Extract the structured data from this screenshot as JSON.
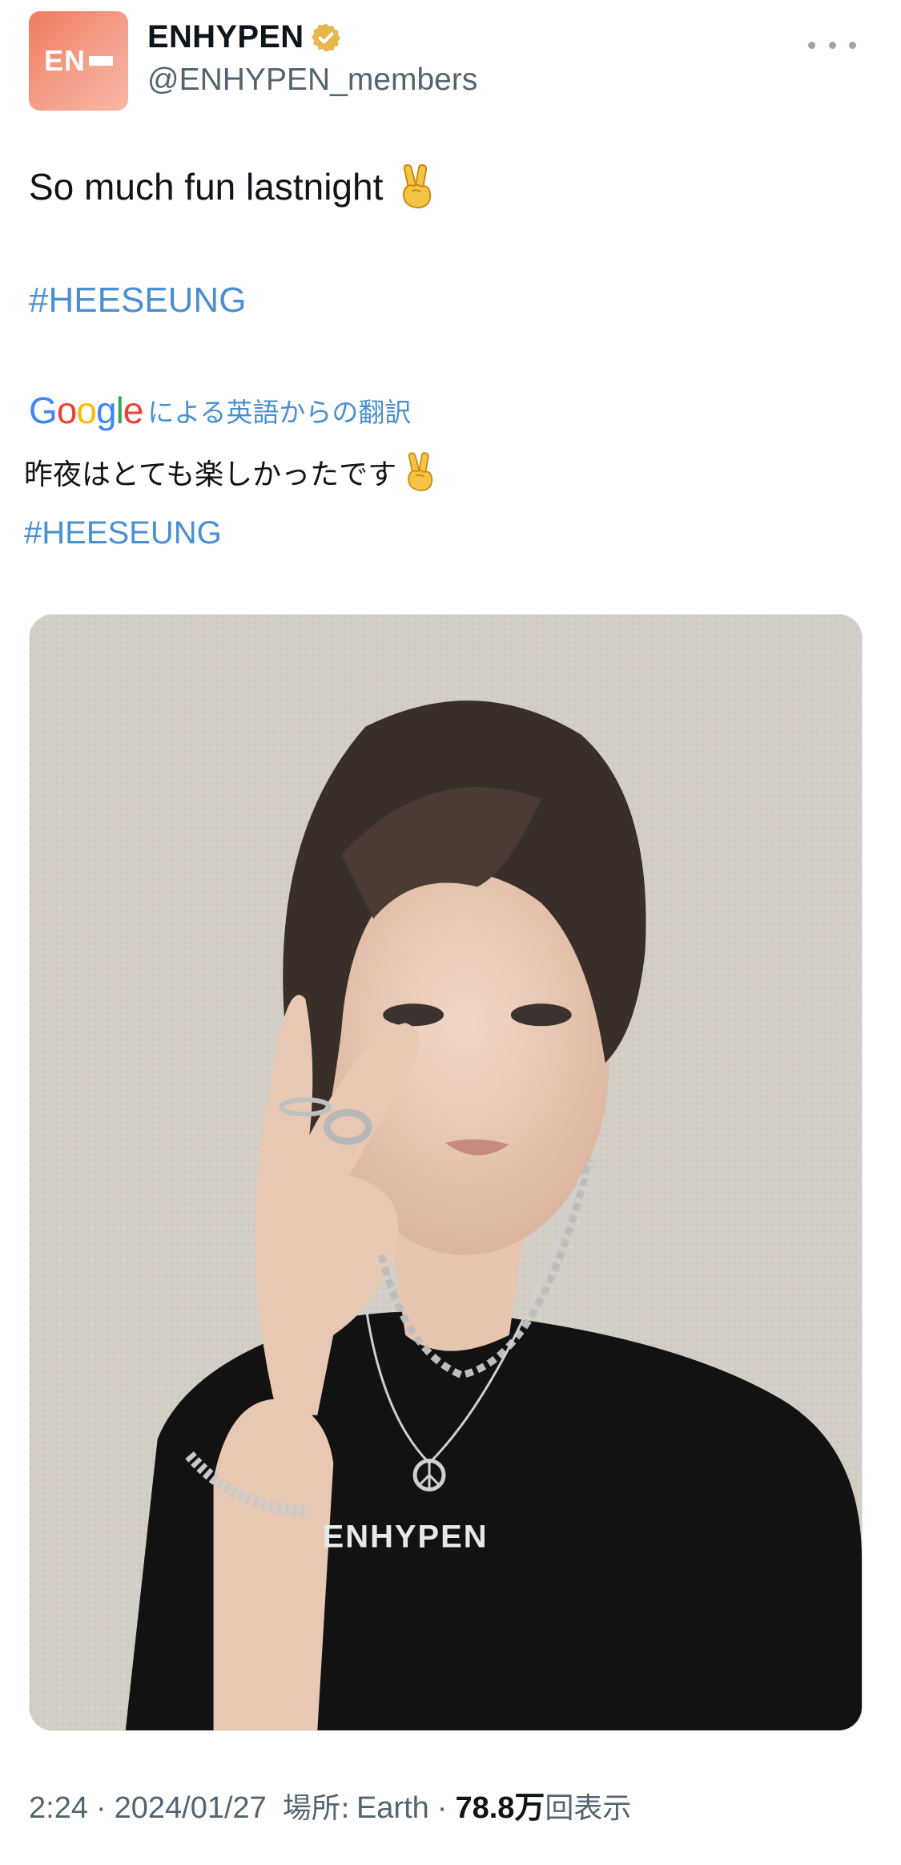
{
  "account": {
    "display_name": "ENHYPEN",
    "handle": "@ENHYPEN_members",
    "avatar_text": "EN",
    "verified": true,
    "verified_color": "#e8b64a"
  },
  "tweet": {
    "text": "So much fun lastnight",
    "emoji": "victory-hand",
    "hashtag": "#HEESEUNG"
  },
  "translation": {
    "provider": "Google",
    "label": "による英語からの翻訳",
    "text": "昨夜はとても楽しかったです",
    "hashtag": "#HEESEUNG"
  },
  "media": {
    "type": "photo",
    "shirt_text": "ENHYPEN"
  },
  "meta": {
    "time": "2:24",
    "date": "2024/01/27",
    "location_label": "場所:",
    "location": "Earth",
    "views_count": "78.8万",
    "views_label": "回表示"
  },
  "colors": {
    "accent_link": "#4a8fd2",
    "text_primary": "#0f1419",
    "text_secondary": "#536471"
  }
}
